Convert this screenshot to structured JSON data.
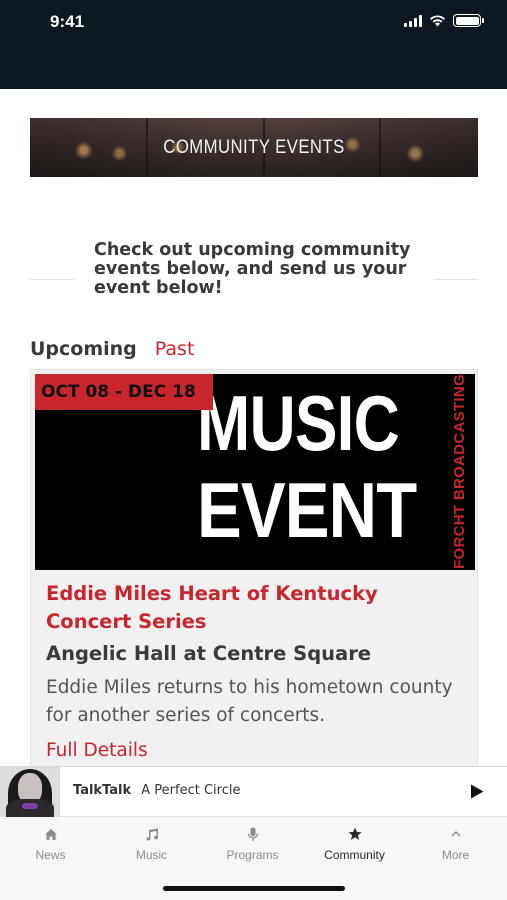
{
  "status_bar": {
    "time": "9:41",
    "background": "#0d1821"
  },
  "banner": {
    "title": "COMMUNITY EVENTS"
  },
  "intro": {
    "text": "Check out upcoming community events below, and send us your event below!"
  },
  "tabs": [
    {
      "label": "Upcoming",
      "active": true
    },
    {
      "label": "Past",
      "active": false
    }
  ],
  "event": {
    "date_range": "OCT 08 - DEC 18",
    "image": {
      "line1": "MUSIC",
      "line2": "EVENT",
      "brand": "FORCHT BROADCASTING"
    },
    "title": "Eddie Miles Heart of Kentucky Concert Series",
    "venue": "Angelic Hall at Centre Square",
    "description": "Eddie Miles returns to his hometown county for another series of concerts.",
    "link_label": "Full Details"
  },
  "now_playing": {
    "station": "TalkTalk",
    "artist": "A Perfect Circle",
    "play_icon": "play-icon"
  },
  "tabbar": [
    {
      "label": "News",
      "icon": "home-icon",
      "active": false
    },
    {
      "label": "Music",
      "icon": "music-note-icon",
      "active": false
    },
    {
      "label": "Programs",
      "icon": "microphone-icon",
      "active": false
    },
    {
      "label": "Community",
      "icon": "star-icon",
      "active": true
    },
    {
      "label": "More",
      "icon": "chevron-up-icon",
      "active": false
    }
  ],
  "colors": {
    "accent": "#c9252c",
    "text": "#3a3a3a",
    "tabbar_bg": "#f7f7f7"
  }
}
